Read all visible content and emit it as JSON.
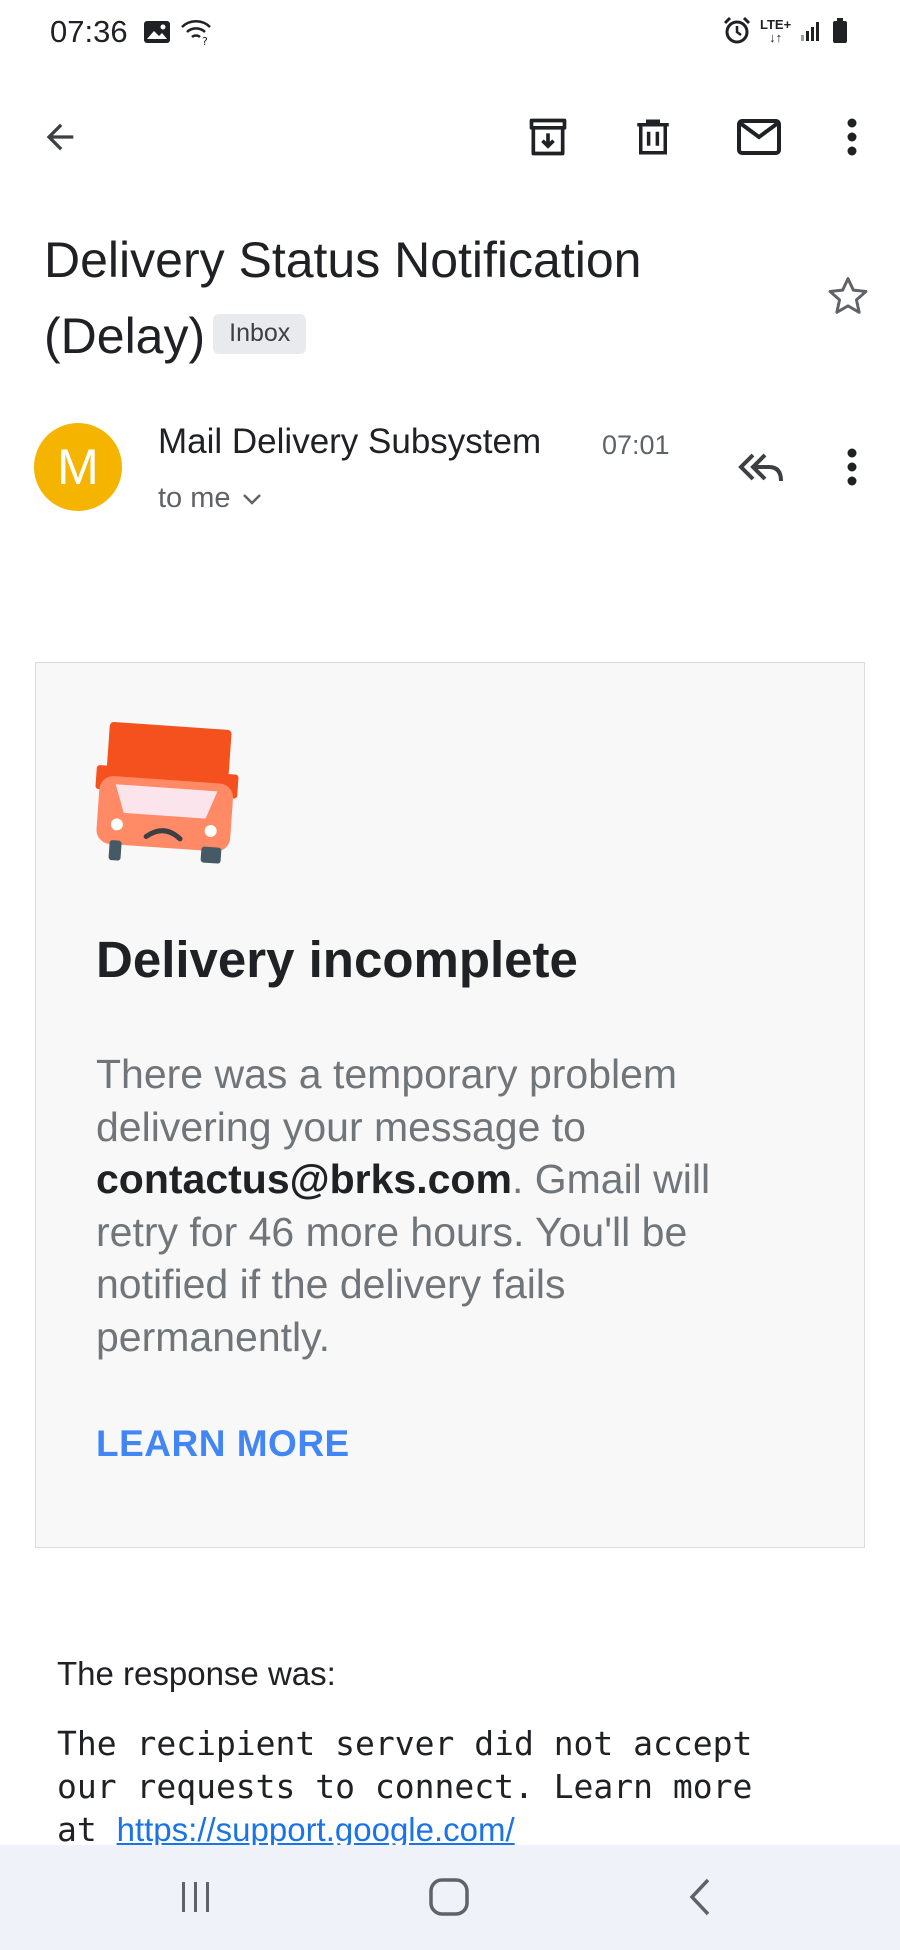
{
  "status_bar": {
    "time": "07:36",
    "network_label": "LTE+",
    "icons": [
      "image-icon",
      "wifi-icon",
      "alarm-icon",
      "lte-icon",
      "signal-icon",
      "battery-icon"
    ]
  },
  "toolbar": {
    "actions": [
      "back-icon",
      "archive-icon",
      "delete-icon",
      "mark-unread-icon",
      "more-options-icon"
    ]
  },
  "email": {
    "subject": "Delivery Status Notification (Delay)",
    "label": "Inbox",
    "starred": false,
    "sender": {
      "avatar_letter": "M",
      "avatar_color": "#f4b400",
      "name": "Mail Delivery Subsystem",
      "time": "07:01",
      "recipient": "to me"
    }
  },
  "card": {
    "title": "Delivery incomplete",
    "body_before": "There was a temporary problem delivering your message to ",
    "recipient_email": "contactus@brks.com",
    "body_after": ". Gmail will retry for 46 more hours. You'll be notified if the delivery fails permanently.",
    "link_label": "LEARN MORE",
    "link_color": "#4285f4"
  },
  "response": {
    "label": "The response was:",
    "text": "The recipient server did not accept\nour requests to connect. Learn more\nat ",
    "link": "https://support.google.com/"
  },
  "nav_bar": {
    "buttons": [
      "recents-icon",
      "home-icon",
      "back-nav-icon"
    ]
  }
}
